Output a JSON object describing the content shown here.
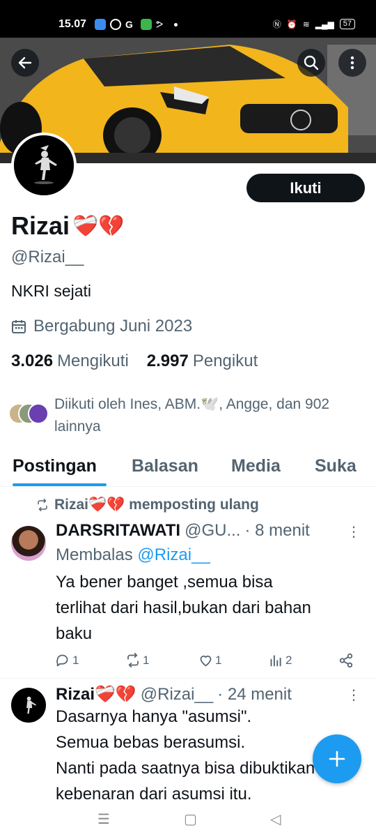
{
  "status_bar": {
    "time": "15.07",
    "battery": "57"
  },
  "header": {
    "back_icon": "arrow-left-icon",
    "search_icon": "search-icon",
    "more_icon": "more-vertical-icon"
  },
  "profile": {
    "name": "Rizai",
    "name_emojis": "❤️‍🩹💔",
    "handle": "@Rizai__",
    "bio": "NKRI sejati",
    "joined": "Bergabung Juni 2023",
    "following_count": "3.026",
    "following_label": "Mengikuti",
    "followers_count": "2.997",
    "followers_label": "Pengikut",
    "followed_by": "Diikuti oleh Ines, ABM.🕊️, Angge, dan 902 lainnya",
    "follow_button": "Ikuti"
  },
  "tabs": [
    {
      "label": "Postingan",
      "active": true
    },
    {
      "label": "Balasan"
    },
    {
      "label": "Media"
    },
    {
      "label": "Suka"
    }
  ],
  "posts": [
    {
      "repost_text": "Rizai❤️‍🩹💔 memposting ulang",
      "author": "DARSRITAWATI",
      "handle": "@GU...",
      "time": "· 8 menit",
      "reply_prefix": "Membalas",
      "reply_handle": "@Rizai__",
      "body": [
        "Ya bener banget ,semua bisa",
        "terlihat dari hasil,bukan dari bahan",
        "baku"
      ],
      "replies": "1",
      "reposts": "1",
      "likes": "1",
      "views": "2"
    },
    {
      "author": "Rizai❤️‍🩹💔",
      "handle": "@Rizai__",
      "time": "· 24 menit",
      "body": [
        "Dasarnya hanya \"asumsi\".",
        "Semua bebas berasumsi.",
        "Nanti pada saatnya bisa dibuktikan",
        "kebenaran dari asumsi itu."
      ]
    }
  ],
  "colors": {
    "accent": "#1d9bf0",
    "text": "#0f1419",
    "muted": "#536471",
    "car": "#f2b51c"
  }
}
